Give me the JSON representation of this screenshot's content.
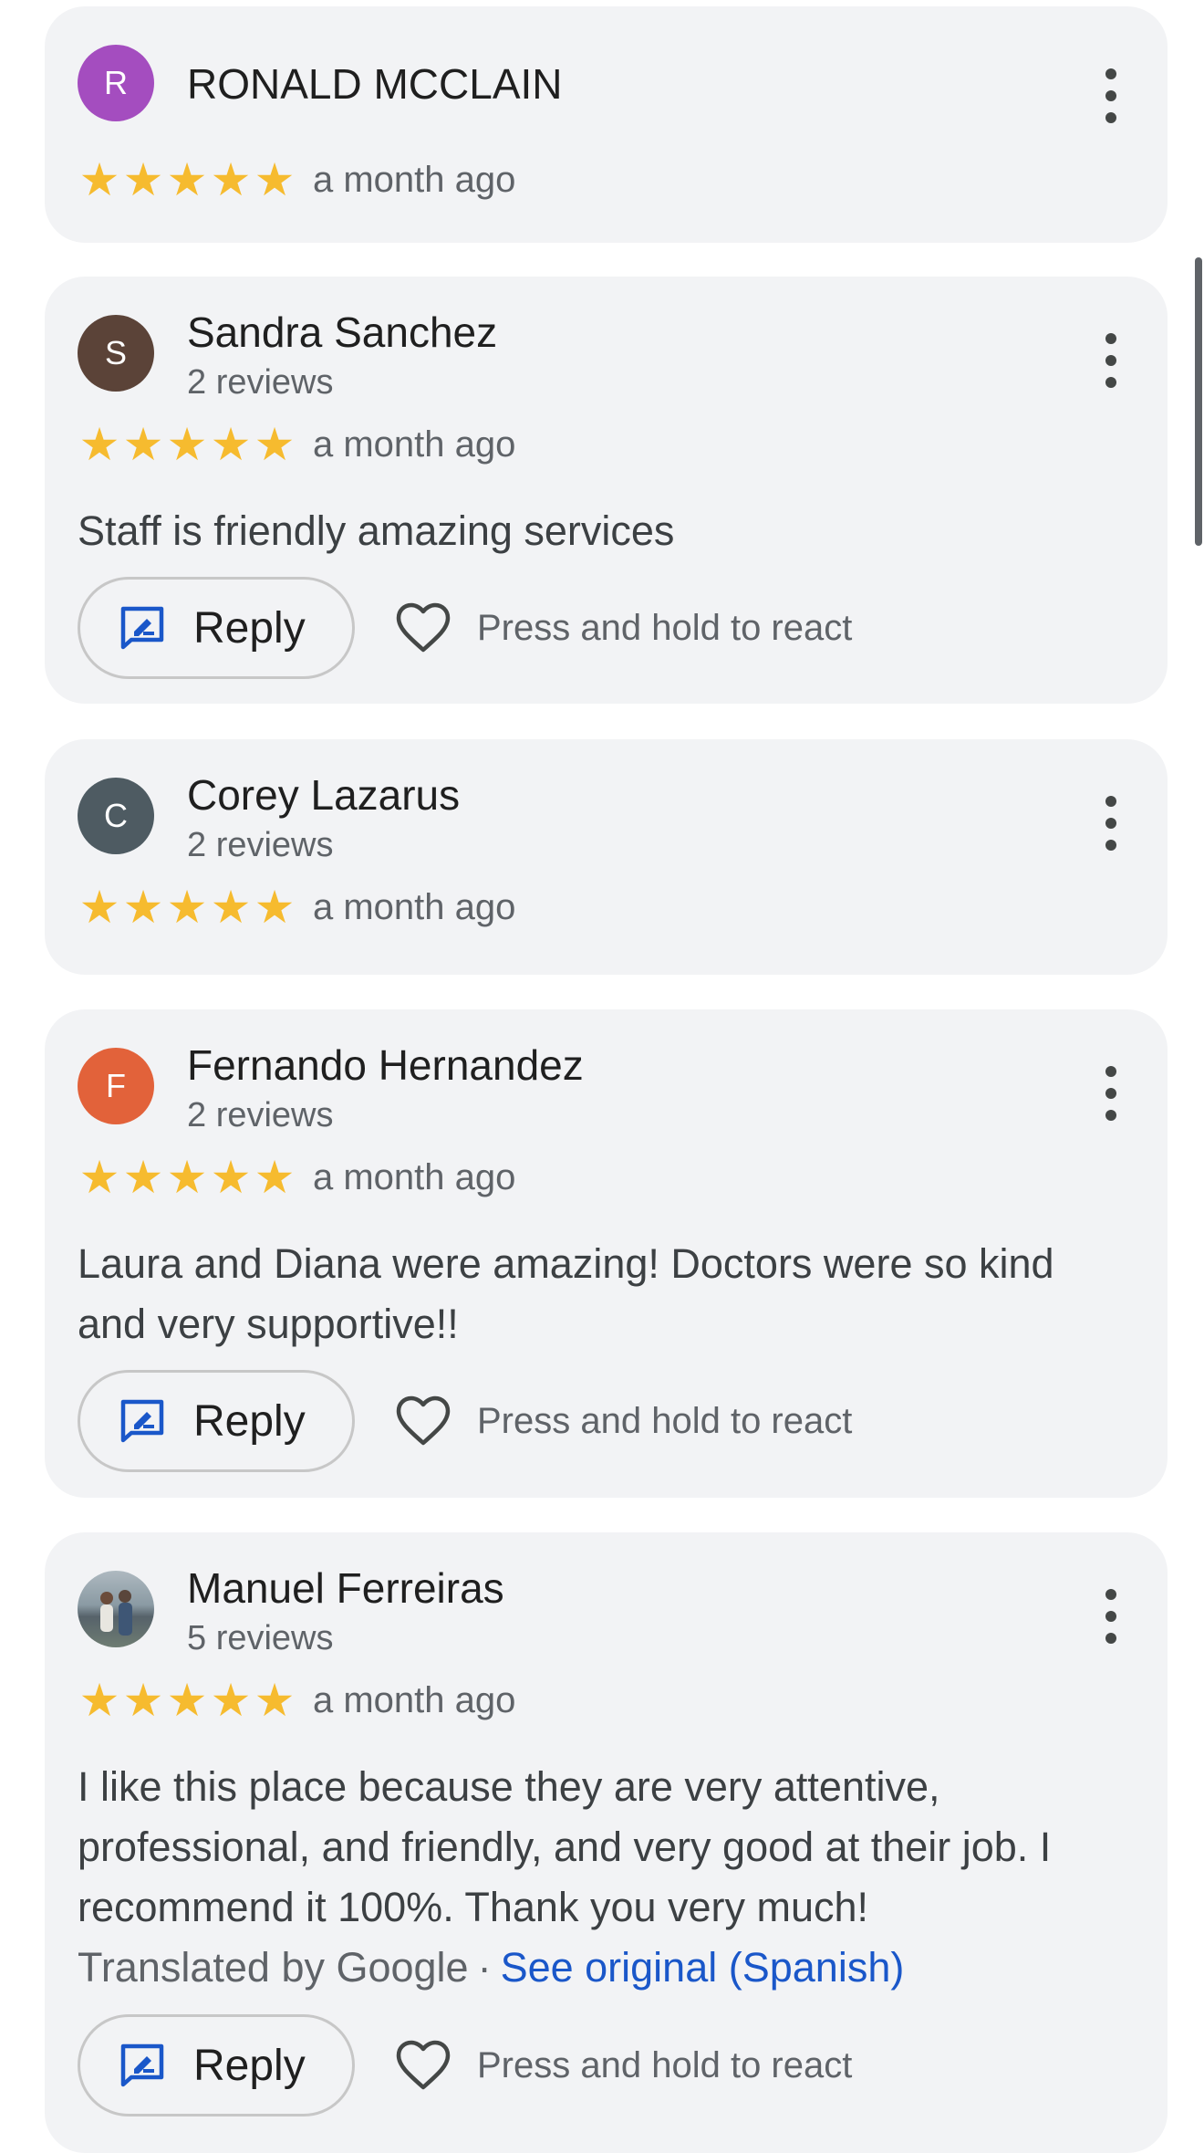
{
  "colors": {
    "star": "#f6bb2f",
    "link": "#1a57c9",
    "card_bg": "#f2f3f5"
  },
  "icons": {
    "more": "more-vert-icon",
    "reply": "reply-icon",
    "react": "heart-icon",
    "star": "star-icon"
  },
  "reviews": [
    {
      "initial": "R",
      "avatar_color": "#a44dbf",
      "name": "RONALD MCCLAIN",
      "review_count": "",
      "rating": 5,
      "time": "a month ago",
      "text": ""
    },
    {
      "initial": "S",
      "avatar_color": "#5b4338",
      "name": "Sandra Sanchez",
      "review_count": "2 reviews",
      "rating": 5,
      "time": "a month ago",
      "text": "Staff is friendly amazing services",
      "reply_label": "Reply",
      "react_label": "Press and hold to react"
    },
    {
      "initial": "C",
      "avatar_color": "#4e5b62",
      "name": "Corey Lazarus",
      "review_count": "2 reviews",
      "rating": 5,
      "time": "a month ago",
      "text": ""
    },
    {
      "initial": "F",
      "avatar_color": "#e2623a",
      "name": "Fernando Hernandez",
      "review_count": "2 reviews",
      "rating": 5,
      "time": "a month ago",
      "text": "Laura and Diana were amazing! Doctors were so kind and very supportive!!",
      "reply_label": "Reply",
      "react_label": "Press and hold to react"
    },
    {
      "initial": "",
      "avatar_color": "#7a8d96",
      "name": "Manuel Ferreiras",
      "review_count": "5 reviews",
      "rating": 5,
      "time": "a month ago",
      "text": "I like this place because they are very attentive, professional, and friendly, and very good at their job. I recommend it 100%. Thank you very much!",
      "translated_label": "Translated by Google",
      "separator": "·",
      "see_original": "See original (Spanish)",
      "reply_label": "Reply",
      "react_label": "Press and hold to react"
    }
  ]
}
